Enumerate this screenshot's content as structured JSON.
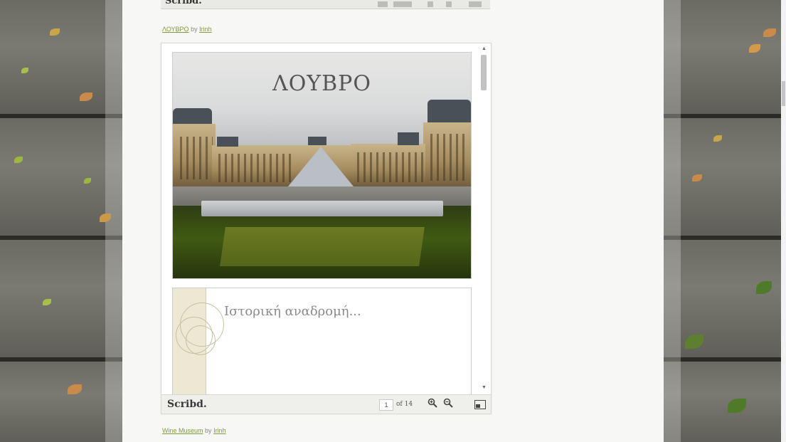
{
  "header": {
    "brand": "Scribd."
  },
  "documents": [
    {
      "title": "ΛΟΥΒΡΟ",
      "by": "by",
      "author": "Irinh"
    },
    {
      "title": "Wine Museum",
      "by": "by",
      "author": "Irinh"
    }
  ],
  "viewer": {
    "page1_title": "ΛΟΥΒΡΟ",
    "page2_title": "Ιστορική αναδρομή...",
    "brand": "Scribd.",
    "current_page": "1",
    "total_pages": "of 14"
  },
  "icons": {
    "zoom_in": "zoom-in-icon",
    "zoom_out": "zoom-out-icon",
    "fullscreen": "fullscreen-icon",
    "scroll_up": "scroll-up-arrow-icon",
    "scroll_down": "scroll-down-arrow-icon"
  },
  "colors": {
    "link": "#7e9b3a",
    "page_bg": "#f7f7f5"
  }
}
